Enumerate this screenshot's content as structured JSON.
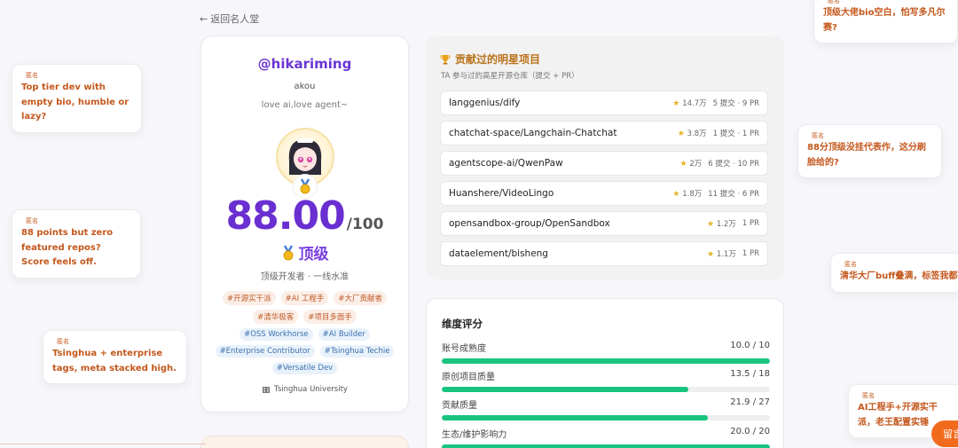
{
  "nav": {
    "back_label": "返回名人堂"
  },
  "profile": {
    "handle": "@hikariming",
    "display_name": "akou",
    "bio": "love ai,love agent~",
    "score": "88.00",
    "score_max": "/100",
    "tier": "顶级",
    "tier_desc": "顶级开发者 · 一线水准",
    "tags": [
      "#开源实干派",
      "#AI 工程手",
      "#大厂贡献者",
      "#清华极客",
      "#项目多面手",
      "#OSS Workhorse",
      "#AI Builder",
      "#Enterprise Contributor",
      "#Tsinghua Techie",
      "#Versatile Dev"
    ],
    "school": "Tsinghua University"
  },
  "projects": {
    "title": "贡献过的明星项目",
    "subtitle": "TA 参与过的高星开源仓库（提交 + PR）",
    "repos": [
      {
        "name": "langgenius/dify",
        "stars": "14.7万",
        "stats": "5 提交 · 9 PR"
      },
      {
        "name": "chatchat-space/Langchain-Chatchat",
        "stars": "3.8万",
        "stats": "1 提交 · 1 PR"
      },
      {
        "name": "agentscope-ai/QwenPaw",
        "stars": "2万",
        "stats": "6 提交 · 10 PR"
      },
      {
        "name": "Huanshere/VideoLingo",
        "stars": "1.8万",
        "stats": "11 提交 · 6 PR"
      },
      {
        "name": "opensandbox-group/OpenSandbox",
        "stars": "1.2万",
        "stats": "1 PR"
      },
      {
        "name": "dataelement/bisheng",
        "stars": "1.1万",
        "stats": "1 PR"
      }
    ]
  },
  "dimensions": {
    "title": "维度评分",
    "items": [
      {
        "label": "账号成熟度",
        "score": "10.0 / 10",
        "fraction": 1.0
      },
      {
        "label": "原创项目质量",
        "score": "13.5 / 18",
        "fraction": 0.75
      },
      {
        "label": "贡献质量",
        "score": "21.9 / 27",
        "fraction": 0.811
      },
      {
        "label": "生态/维护影响力",
        "score": "20.0 / 20",
        "fraction": 1.0
      }
    ]
  },
  "comments": [
    {
      "author": "匿名",
      "text": "Top tier dev with empty bio, humble or lazy?"
    },
    {
      "author": "匿名",
      "text": "88 points but zero featured repos? Score feels off."
    },
    {
      "author": "匿名",
      "text": "Tsinghua + enterprise tags, meta stacked high."
    },
    {
      "author": "匿名",
      "text": "顶级大佬bio空白，怕写多凡尔赛?"
    },
    {
      "author": "匿名",
      "text": "88分顶级没挂代表作，这分刷脸给的?"
    },
    {
      "author": "匿名",
      "text": "清华大厂buff叠满，标签我都想抄"
    },
    {
      "author": "匿名",
      "text": "AI工程手+开源实干派，老王配置实锤"
    }
  ],
  "leave_button": "留言",
  "colors": {
    "accent_purple": "#6a2fd0",
    "progress_green": "#18c47e",
    "comment_orange": "#c4581d",
    "button_orange": "#f26b1d"
  }
}
